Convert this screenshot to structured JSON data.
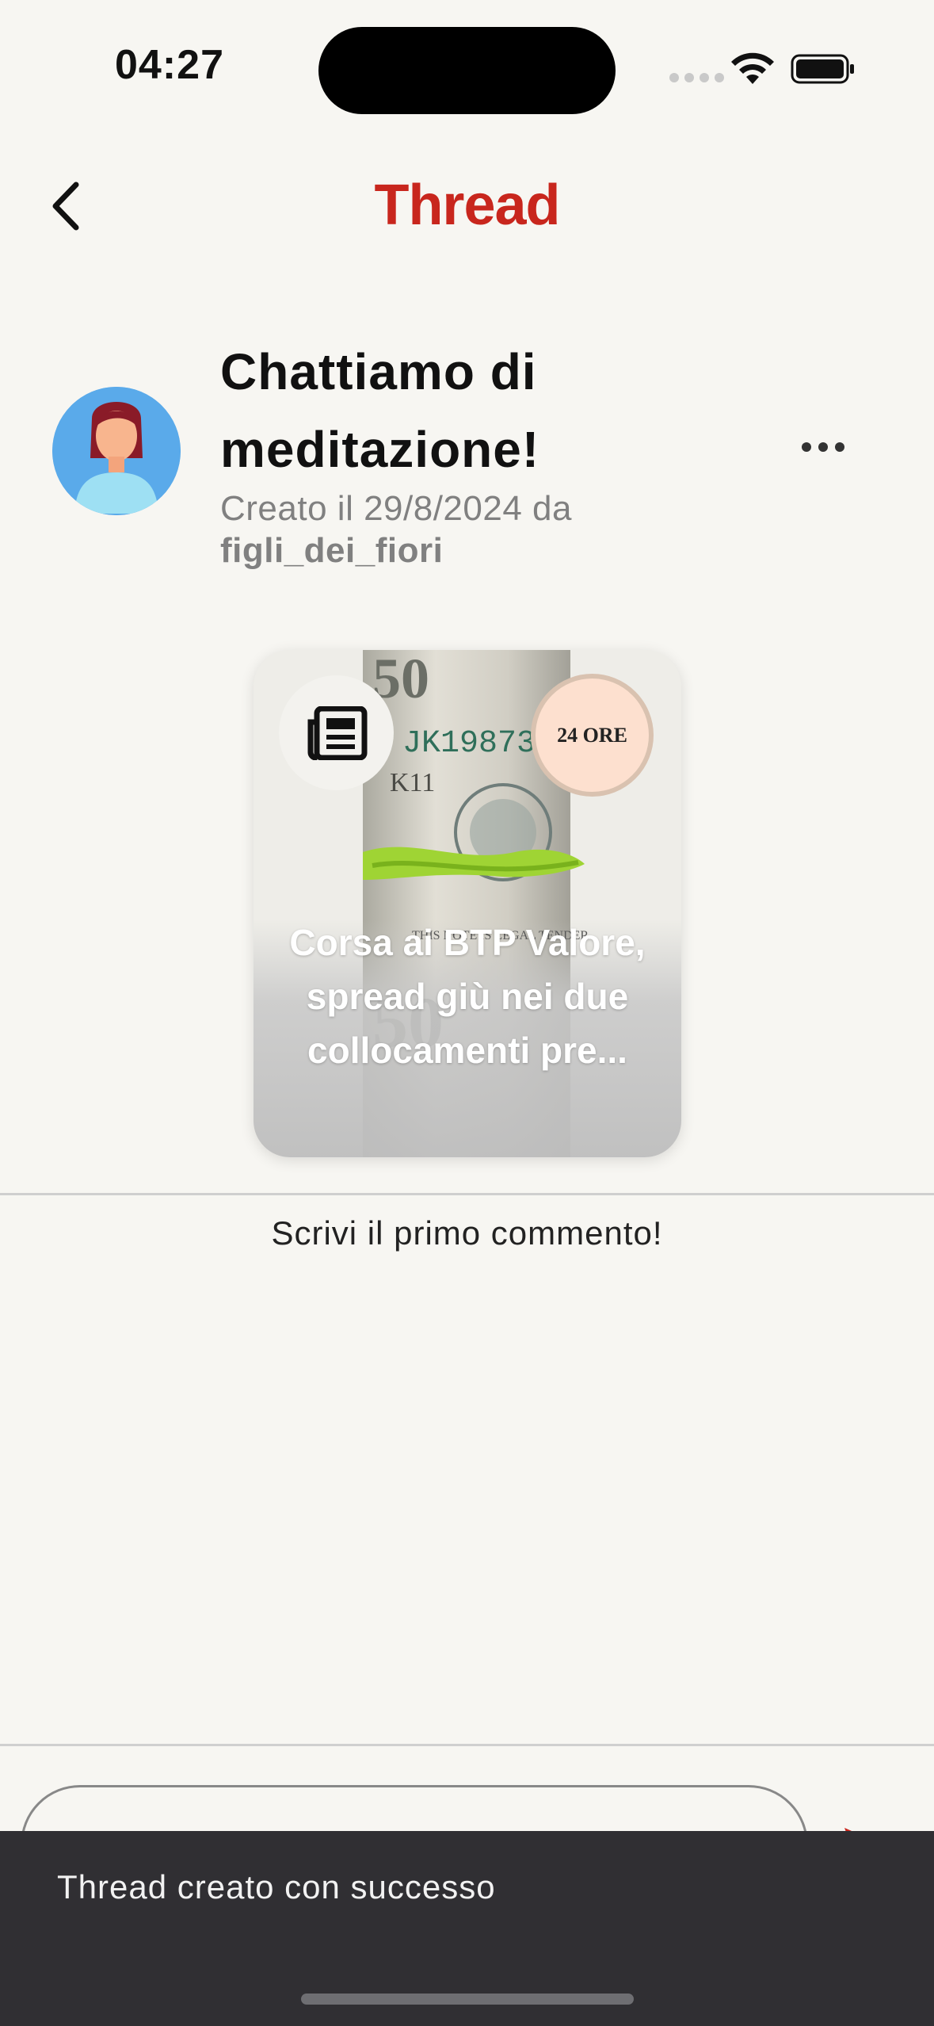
{
  "status_bar": {
    "time": "04:27"
  },
  "nav": {
    "title": "Thread",
    "title_color": "#c8261d",
    "back_icon": "chevron-left-icon"
  },
  "thread": {
    "title": "Chattiamo di meditazione!",
    "created_line": "Creato il 29/8/2024 da",
    "author": "figli_dei_fiori",
    "more_icon": "more-horizontal-icon"
  },
  "news_card": {
    "headline": "Corsa ai BTP Valore, spread giù nei due collocamenti pre...",
    "type_icon": "newspaper-icon",
    "source_logo_text": "24 ORE"
  },
  "comments": {
    "empty_text": "Scrivi il primo commento!"
  },
  "composer": {
    "send_icon": "send-icon"
  },
  "snackbar": {
    "message": "Thread creato con successo"
  }
}
